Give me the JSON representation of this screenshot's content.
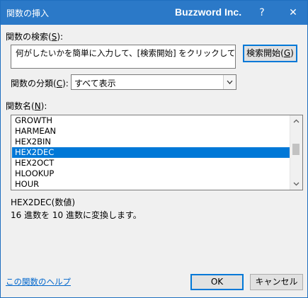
{
  "titlebar": {
    "title": "関数の挿入",
    "brand": "Buzzword Inc.",
    "help_label": "?",
    "close_label": "✕"
  },
  "search": {
    "label_prefix": "関数の検索(",
    "label_key": "S",
    "label_suffix": "):",
    "value": "何がしたいかを簡単に入力して、[検索開始] をクリックしてください。",
    "button_prefix": "検索開始(",
    "button_key": "G",
    "button_suffix": ")"
  },
  "category": {
    "label_prefix": "関数の分類(",
    "label_key": "C",
    "label_suffix": "):",
    "selected": "すべて表示"
  },
  "function_list": {
    "label_prefix": "関数名(",
    "label_key": "N",
    "label_suffix": "):",
    "items": [
      "GROWTH",
      "HARMEAN",
      "HEX2BIN",
      "HEX2DEC",
      "HEX2OCT",
      "HLOOKUP",
      "HOUR"
    ],
    "selected_index": 3
  },
  "description": {
    "syntax": "HEX2DEC(数値)",
    "text": "16 進数を 10 進数に変換します。"
  },
  "footer": {
    "help_link": "この関数のヘルプ",
    "ok_label": "OK",
    "cancel_label": "キャンセル"
  }
}
